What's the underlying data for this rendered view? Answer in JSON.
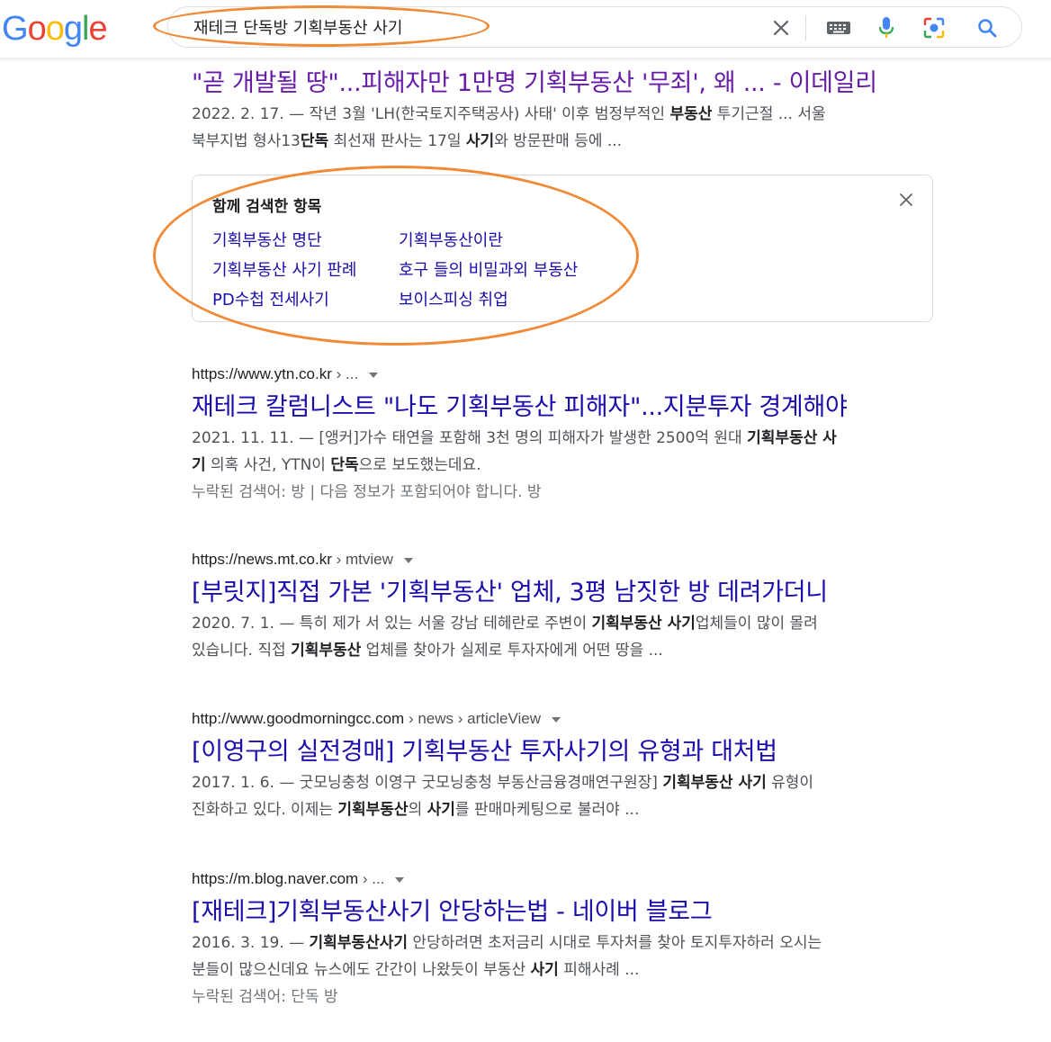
{
  "logo": {
    "letters": [
      "G",
      "o",
      "o",
      "g",
      "l",
      "e"
    ]
  },
  "search": {
    "query": "재테크 단독방 기획부동산 사기"
  },
  "results": [
    {
      "title": "\"곧 개발될 땅\"...피해자만 1만명 기획부동산 '무죄', 왜 ... - 이데일리",
      "snippet_line1": [
        {
          "t": "2022. 2. 17. — ",
          "b": false
        },
        {
          "t": "작년 3월 'LH(한국토지주택공사) 사태' 이후 범정부적인 ",
          "b": false
        },
        {
          "t": "부동산",
          "b": true
        },
        {
          "t": " 투기근절 ... 서울",
          "b": false
        }
      ],
      "snippet_line2": [
        {
          "t": "북부지법 형사13",
          "b": false
        },
        {
          "t": "단독",
          "b": true
        },
        {
          "t": " 최선재 판사는 17일 ",
          "b": false
        },
        {
          "t": "사기",
          "b": true
        },
        {
          "t": "와 방문판매 등에 ...",
          "b": false
        }
      ]
    },
    {
      "cite_domain": "https://www.ytn.co.kr",
      "cite_path": " › ...",
      "title": "재테크 칼럼니스트 \"나도 기획부동산 피해자\"...지분투자 경계해야",
      "snippet_line1": [
        {
          "t": "2021. 11. 11. — ",
          "b": false
        },
        {
          "t": "[앵커]가수 태연을 포함해 3천 명의 피해자가 발생한 2500억 원대 ",
          "b": false
        },
        {
          "t": "기획부동산 사",
          "b": true
        }
      ],
      "snippet_line2": [
        {
          "t": "기",
          "b": true
        },
        {
          "t": " 의혹 사건, YTN이 ",
          "b": false
        },
        {
          "t": "단독",
          "b": true
        },
        {
          "t": "으로 보도했는데요.",
          "b": false
        }
      ],
      "missing_label": "누락된 검색어: 방 | 다음 정보가 포함되어야 합니다. 방"
    },
    {
      "cite_domain": "https://news.mt.co.kr",
      "cite_path": " › mtview",
      "title": "[부릿지]직접 가본 '기획부동산' 업체, 3평 남짓한 방 데려가더니",
      "snippet_line1": [
        {
          "t": "2020. 7. 1. — ",
          "b": false
        },
        {
          "t": "특히 제가 서 있는 서울 강남 테헤란로 주변이 ",
          "b": false
        },
        {
          "t": "기획부동산 사기",
          "b": true
        },
        {
          "t": "업체들이 많이 몰려",
          "b": false
        }
      ],
      "snippet_line2": [
        {
          "t": "있습니다. 직접 ",
          "b": false
        },
        {
          "t": "기획부동산",
          "b": true
        },
        {
          "t": " 업체를 찾아가 실제로 투자자에게 어떤 땅을 ...",
          "b": false
        }
      ]
    },
    {
      "cite_domain": "http://www.goodmorningcc.com",
      "cite_path": " › news › articleView",
      "title": "[이영구의 실전경매] 기획부동산 투자사기의 유형과 대처법",
      "snippet_line1": [
        {
          "t": "2017. 1. 6. — ",
          "b": false
        },
        {
          "t": "굿모닝충청 이영구 굿모닝충청 부동산금융경매연구원장] ",
          "b": false
        },
        {
          "t": "기획부동산 사기",
          "b": true
        },
        {
          "t": " 유형이",
          "b": false
        }
      ],
      "snippet_line2": [
        {
          "t": "진화하고 있다. 이제는 ",
          "b": false
        },
        {
          "t": "기획부동산",
          "b": true
        },
        {
          "t": "의 ",
          "b": false
        },
        {
          "t": "사기",
          "b": true
        },
        {
          "t": "를 판매마케팅으로 불러야 ...",
          "b": false
        }
      ]
    },
    {
      "cite_domain": "https://m.blog.naver.com",
      "cite_path": " › ...",
      "title": "[재테크]기획부동산사기 안당하는법 - 네이버 블로그",
      "snippet_line1": [
        {
          "t": "2016. 3. 19. — ",
          "b": false
        },
        {
          "t": "기획부동산사기",
          "b": true
        },
        {
          "t": " 안당하려면 초저금리 시대로 투자처를 찾아 토지투자하러 오시는",
          "b": false
        }
      ],
      "snippet_line2": [
        {
          "t": "분들이 많으신데요 뉴스에도 간간이 나왔듯이 부동산 ",
          "b": false
        },
        {
          "t": "사기",
          "b": true
        },
        {
          "t": " 피해사례 ...",
          "b": false
        }
      ],
      "missing_label": "누락된 검색어: 단독 방"
    }
  ],
  "related": {
    "title": "함께 검색한 항목",
    "links": [
      "기획부동산 명단",
      "기획부동산이란",
      "기획부동산 사기 판례",
      "호구 들의 비밀과외 부동산",
      "PD수첩 전세사기",
      "보이스피싱 취업"
    ]
  },
  "colors": {
    "annotation": "#f08a37",
    "link": "#1a0dab",
    "visited": "#681da8"
  }
}
